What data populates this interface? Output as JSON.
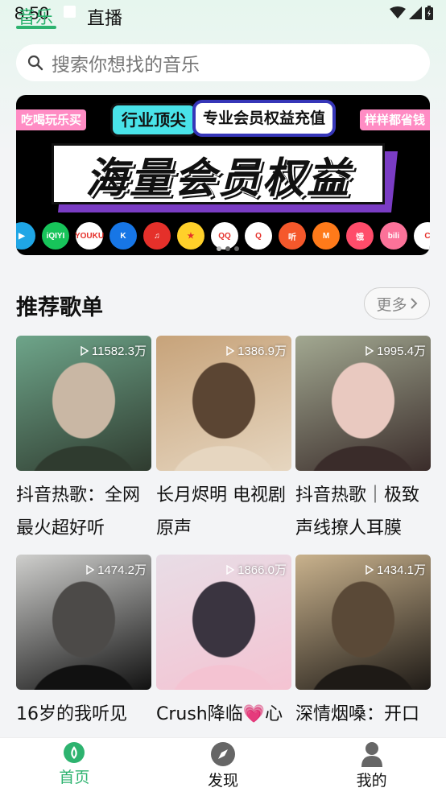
{
  "status_bar": {
    "time": "8:50"
  },
  "tabs": {
    "music": "音乐",
    "live": "直播"
  },
  "search": {
    "placeholder": "搜索你想找的音乐"
  },
  "banner": {
    "tag_left": "吃喝玩乐买",
    "tag_right": "样样都省钱",
    "pill_1": "行业顶尖",
    "pill_2": "专业会员权益充值",
    "headline": "海量会员权益",
    "partner_icons": [
      {
        "name": "play-logo",
        "color": "#1fa6e6",
        "text": "▶"
      },
      {
        "name": "iqiyi-logo",
        "color": "#17c45a",
        "text": "iQIYI"
      },
      {
        "name": "youku-logo",
        "color": "#ffffff",
        "text": "YOUKU"
      },
      {
        "name": "kugou-logo",
        "color": "#1776e6",
        "text": "K"
      },
      {
        "name": "netease-music-logo",
        "color": "#e5302a",
        "text": "♫"
      },
      {
        "name": "mango-logo",
        "color": "#ffd02a",
        "text": "★"
      },
      {
        "name": "qq-logo",
        "color": "#ffffff",
        "text": "QQ"
      },
      {
        "name": "qq-music-logo",
        "color": "#ffffff",
        "text": "Q"
      },
      {
        "name": "ximalaya-logo",
        "color": "#f5582b",
        "text": "听"
      },
      {
        "name": "mgtv-logo",
        "color": "#ff7a1a",
        "text": "M"
      },
      {
        "name": "ele-logo",
        "color": "#ff4c6a",
        "text": "饿"
      },
      {
        "name": "bilibili-logo",
        "color": "#fb7299",
        "text": "bili"
      },
      {
        "name": "extra-logo",
        "color": "#ffffff",
        "text": "C"
      }
    ]
  },
  "recommend": {
    "title": "推荐歌单",
    "more_label": "更多",
    "playlists": [
      {
        "title": "抖音热歌：全网最火超好听",
        "plays": "11582.3万",
        "colors": [
          "#6ea58a",
          "#c9b7a4",
          "#2f3b2f"
        ]
      },
      {
        "title": "长月烬明 电视剧原声",
        "plays": "1386.9万",
        "colors": [
          "#c7a37a",
          "#5b4533",
          "#e6d6c0"
        ]
      },
      {
        "title": "抖音热歌｜极致声线撩人耳膜",
        "plays": "1995.4万",
        "colors": [
          "#a2a891",
          "#e9c9c0",
          "#3a2c2a"
        ]
      },
      {
        "title": "16岁的我听见",
        "plays": "1474.2万",
        "colors": [
          "#cfcfcd",
          "#4c4a48",
          "#111111"
        ]
      },
      {
        "title": "Crush降临💗心",
        "plays": "1866.0万",
        "colors": [
          "#e8dde6",
          "#3a3440",
          "#f4c3d2"
        ]
      },
      {
        "title": "深情烟嗓：开口",
        "plays": "1434.1万",
        "colors": [
          "#c9b28d",
          "#5a4937",
          "#1e1a16"
        ]
      }
    ]
  },
  "bottom_nav": [
    {
      "label": "首页",
      "icon": "home-icon",
      "active": true
    },
    {
      "label": "发现",
      "icon": "compass-icon",
      "active": false
    },
    {
      "label": "我的",
      "icon": "user-icon",
      "active": false
    }
  ],
  "colors": {
    "accent": "#2db36f",
    "banner_bg": "#000000",
    "purple": "#7a3cc4"
  }
}
